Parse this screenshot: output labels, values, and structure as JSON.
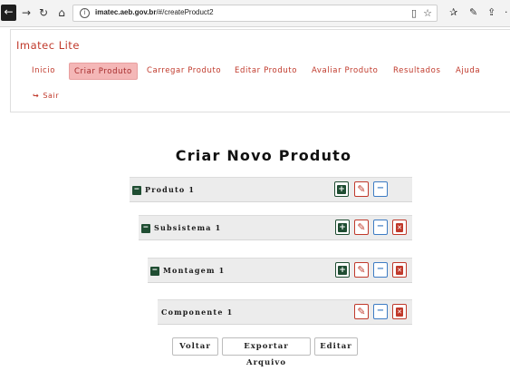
{
  "browser": {
    "url_host": "imatec.aeb.gov.br",
    "url_path": "/#/createProduct2"
  },
  "app": {
    "brand": "Imatec Lite",
    "menu": [
      {
        "label": "Inicio",
        "active": false
      },
      {
        "label": "Criar Produto",
        "active": true
      },
      {
        "label": "Carregar Produto",
        "active": false
      },
      {
        "label": "Editar Produto",
        "active": false
      },
      {
        "label": "Avaliar Produto",
        "active": false
      },
      {
        "label": "Resultados",
        "active": false
      },
      {
        "label": "Ajuda",
        "active": false
      }
    ],
    "logout": "Sair"
  },
  "main": {
    "title": "Criar Novo Produto",
    "tree": [
      {
        "label": "Produto 1",
        "expandable": true,
        "buttons": [
          "add",
          "edit",
          "collapse"
        ]
      },
      {
        "label": "Subsistema 1",
        "expandable": true,
        "buttons": [
          "add",
          "edit",
          "collapse",
          "delete"
        ]
      },
      {
        "label": "Montagem 1",
        "expandable": true,
        "buttons": [
          "add",
          "edit",
          "collapse",
          "delete"
        ]
      },
      {
        "label": "Componente 1",
        "expandable": false,
        "buttons": [
          "edit",
          "collapse",
          "delete"
        ]
      }
    ],
    "actions": {
      "back": "Voltar",
      "export": "Exportar Arquivo",
      "edit": "Editar"
    }
  },
  "colors": {
    "accent": "#c0392b",
    "active_tab_bg": "#f4b7b7",
    "add_green": "#1f4d32",
    "collapse_blue": "#3e7cc4",
    "row_bg": "#ececec"
  }
}
